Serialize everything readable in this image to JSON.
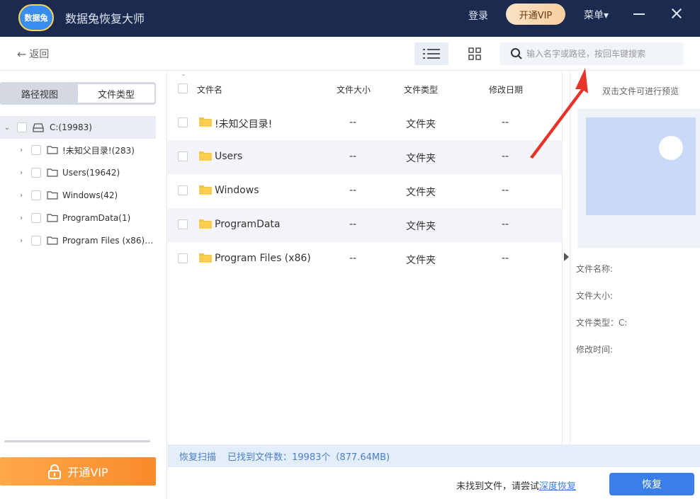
{
  "app": {
    "logo_text": "数据兔",
    "title": "数据兔恢复大师",
    "login": "登录",
    "vip_pill": "开通VIP",
    "menu": "菜单▾"
  },
  "toolbar": {
    "back": "返回",
    "search_placeholder": "输入名字或路径，按回车键搜索"
  },
  "left": {
    "tab_path": "路径视图",
    "tab_type": "文件类型",
    "tree": {
      "root": "C:(19983)",
      "children": [
        "!未知父目录!(283)",
        "Users(19642)",
        "Windows(42)",
        "ProgramData(1)",
        "Program Files (x86)(..."
      ]
    },
    "vip_button": "开通VIP"
  },
  "table": {
    "headers": {
      "name": "文件名",
      "size": "文件大小",
      "type": "文件类型",
      "date": "修改日期"
    },
    "rows": [
      {
        "name": "!未知父目录!",
        "size": "--",
        "type": "文件夹",
        "date": "--"
      },
      {
        "name": "Users",
        "size": "--",
        "type": "文件夹",
        "date": "--"
      },
      {
        "name": "Windows",
        "size": "--",
        "type": "文件夹",
        "date": "--"
      },
      {
        "name": "ProgramData",
        "size": "--",
        "type": "文件夹",
        "date": "--"
      },
      {
        "name": "Program Files (x86)",
        "size": "--",
        "type": "文件夹",
        "date": "--"
      }
    ]
  },
  "preview": {
    "hint": "双击文件可进行预览",
    "name_label": "文件名称:",
    "size_label": "文件大小:",
    "type_label": "文件类型：C:",
    "time_label": "修改时间:"
  },
  "status": {
    "rescan": "恢复扫描",
    "found": "已找到文件数：19983个（877.64MB)"
  },
  "bottom": {
    "notfound": "未找到文件，请尝试",
    "deep": "深度恢复",
    "recover": "恢复"
  },
  "colors": {
    "titlebar": "#1b2a4e",
    "accent": "#3a7fe8",
    "vip_orange": "#f98a2a",
    "folder": "#f7c23c",
    "annotation": "#e8332a"
  }
}
